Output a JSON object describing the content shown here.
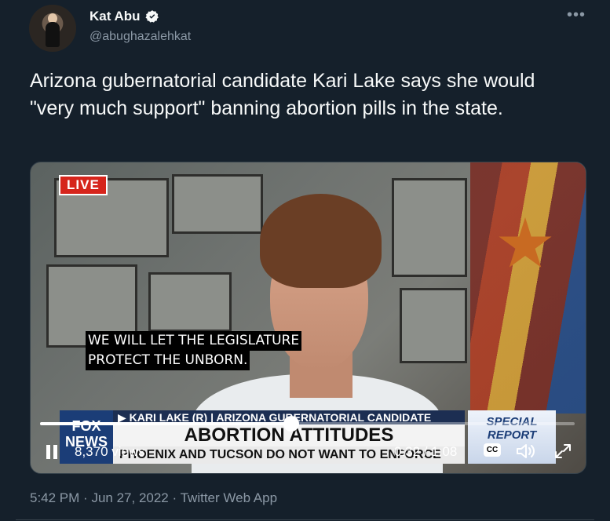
{
  "tweet": {
    "display_name": "Kat Abu",
    "handle": "@abughazalehkat",
    "text": "Arizona gubernatorial candidate Kari Lake says she would \"very much support\" banning abortion pills in the state.",
    "timestamp": "5:42 PM",
    "date": "Jun 27, 2022",
    "separator": "·",
    "source": "Twitter Web App",
    "more_icon": "more-horizontal-icon",
    "verified_icon": "verified-badge-icon"
  },
  "video": {
    "live_label": "LIVE",
    "caption_line1": "WE WILL LET THE LEGISLATURE",
    "caption_line2": "PROTECT THE UNBORN.",
    "fox_logo": "FOX NEWS",
    "chyron_top": "▶ KARI LAKE (R) | ARIZONA GUBERNATORIAL CANDIDATE",
    "chyron_headline": "ABORTION ATTITUDES",
    "chyron_ticker": "PHOENIX AND TUCSON DO NOT WANT TO ENFORCE",
    "special_report_line1": "SPECIAL",
    "special_report_line2": "REPORT",
    "views": "8,370 views",
    "time_display": "0:32 / 1:08",
    "progress_fraction": 0.47,
    "cc_label": "CC",
    "icons": [
      "pause-icon",
      "closed-captions-icon",
      "volume-icon",
      "fullscreen-icon"
    ]
  },
  "colors": {
    "background": "#15202b",
    "text_primary": "#f7f9f9",
    "text_secondary": "#8b98a5",
    "live_red": "#d6251c"
  }
}
